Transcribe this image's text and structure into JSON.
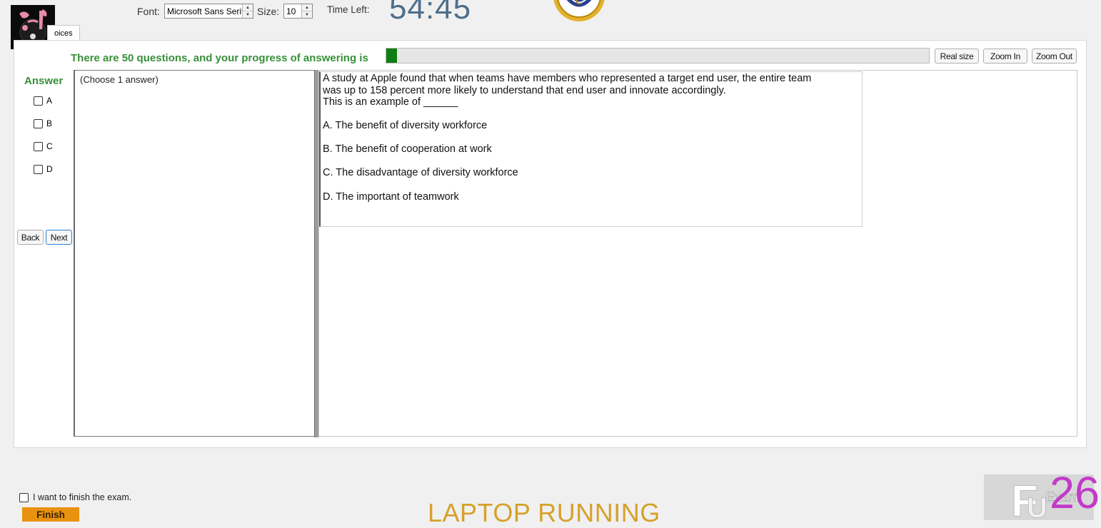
{
  "toolbar": {
    "font_label": "Font:",
    "font_value": "Microsoft Sans Serif",
    "size_label": "Size:",
    "size_value": "10",
    "time_left_label": "Time Left:",
    "timer": "54:45"
  },
  "tab": {
    "label": "oices"
  },
  "progress": {
    "text": "There are 50 questions, and your progress of answering is",
    "fraction": 0.02,
    "fill_color": "#0f7d13"
  },
  "zoom": {
    "real_size": "Real size",
    "zoom_in": "Zoom In",
    "zoom_out": "Zoom Out"
  },
  "answer": {
    "title": "Answer",
    "options": [
      "A",
      "B",
      "C",
      "D"
    ]
  },
  "nav": {
    "back": "Back",
    "next": "Next"
  },
  "hint": "(Choose 1 answer)",
  "question": {
    "lines": [
      "A study at Apple found that when teams have members who represented a target end user, the entire team",
      "was up to 158 percent more likely to understand that end user and innovate accordingly.",
      "This is an example of ______"
    ],
    "choices": [
      "A.  The benefit of diversity workforce",
      "B.  The benefit of cooperation at work",
      "C.  The disadvantage of diversity workforce",
      "D.  The important of teamwork"
    ]
  },
  "footer": {
    "finish_check": "I want to finish the exam.",
    "finish_button": "Finish",
    "watermark": "LAPTOP RUNNING",
    "brand_word": "Exam",
    "brand_number": "26"
  },
  "colors": {
    "accent_green": "#38903a",
    "finish_orange": "#e8920f",
    "timer_blue": "#4e6e8a",
    "brand_magenta": "#c23ac8"
  },
  "icons": [
    "app-logo-icon",
    "club-crest-icon",
    "fu-exam-logo-icon"
  ]
}
